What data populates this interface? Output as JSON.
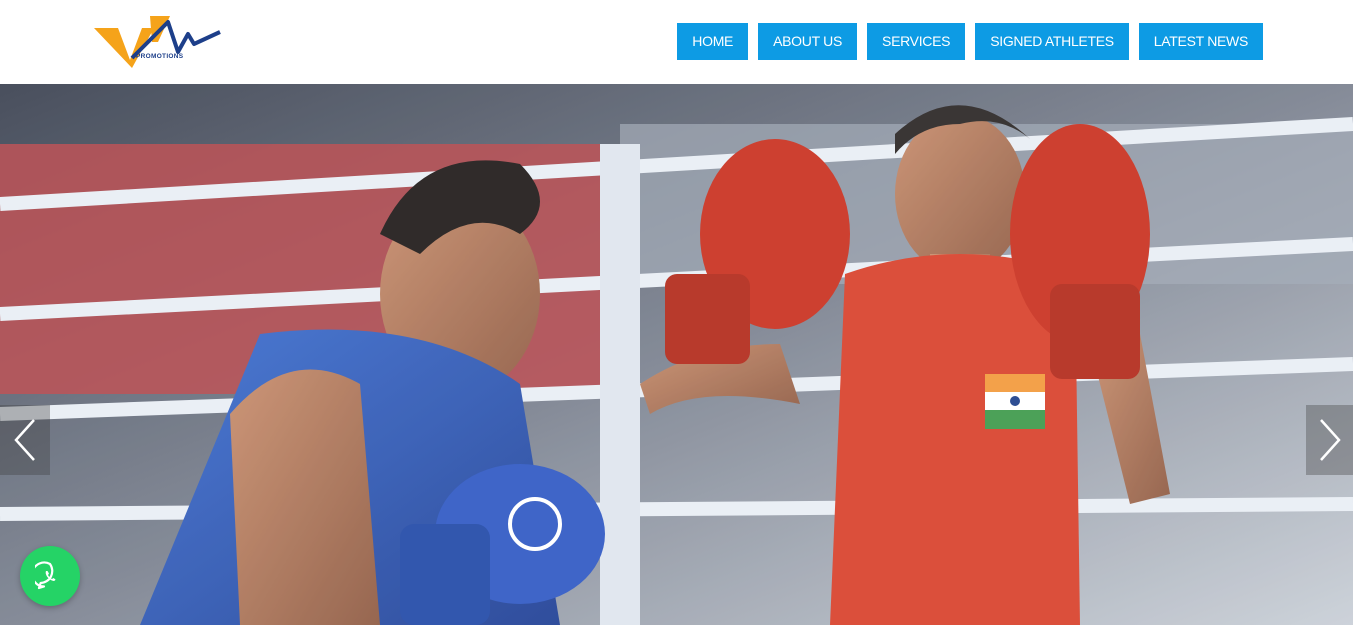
{
  "brand": {
    "logo_text": "PROMOTIONS",
    "colors": {
      "orange": "#f5a31a",
      "blue": "#1d3f8a"
    }
  },
  "nav": {
    "items": [
      {
        "label": "HOME"
      },
      {
        "label": "ABOUT US"
      },
      {
        "label": "SERVICES"
      },
      {
        "label": "SIGNED ATHLETES"
      },
      {
        "label": "LATEST NEWS"
      }
    ],
    "color": "#0d9be4"
  },
  "hero": {
    "slider_prev_icon": "chevron-left-icon",
    "slider_next_icon": "chevron-right-icon"
  },
  "floating": {
    "whatsapp_icon": "whatsapp-icon",
    "color": "#25d366"
  }
}
